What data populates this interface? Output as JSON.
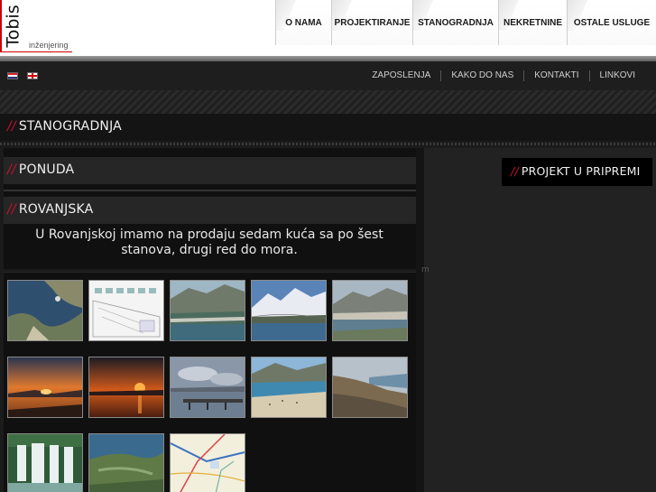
{
  "logo": {
    "name": "Tobis",
    "subtitle": "inženjering"
  },
  "main_nav": [
    {
      "label": "O NAMA"
    },
    {
      "label": "PROJEKTIRANJE"
    },
    {
      "label": "STANOGRADNJA"
    },
    {
      "label": "NEKRETNINE"
    },
    {
      "label": "OSTALE USLUGE"
    }
  ],
  "secondary_nav": [
    {
      "label": "ZAPOSLENJA"
    },
    {
      "label": "KAKO DO NAS"
    },
    {
      "label": "KONTAKTI"
    },
    {
      "label": "LINKOVI"
    }
  ],
  "page_title": {
    "prefix": "//",
    "text": "STANOGRADNJA"
  },
  "sections": {
    "ponuda": {
      "prefix": "//",
      "text": "PONUDA"
    },
    "rovanjska": {
      "prefix": "//",
      "text": "ROVANJSKA"
    }
  },
  "description": "U Rovanjskoj imamo na prodaju sedam kuća sa po šest stanova, drugi red do mora.",
  "sidebar": {
    "prefix": "//",
    "text": "PROJEKT U PRIPREMI"
  },
  "side_mark": "m",
  "gallery": [
    {
      "subject": "aerial-map"
    },
    {
      "subject": "site-plan"
    },
    {
      "subject": "mountain-bay"
    },
    {
      "subject": "snowy-mountains"
    },
    {
      "subject": "coast-mountains"
    },
    {
      "subject": "sunset-orange"
    },
    {
      "subject": "sunset-red"
    },
    {
      "subject": "pier-clouds"
    },
    {
      "subject": "beach"
    },
    {
      "subject": "hillside-sea"
    },
    {
      "subject": "waterfall"
    },
    {
      "subject": "aerial-green"
    },
    {
      "subject": "road-map"
    }
  ],
  "colors": {
    "accent": "#c8102e",
    "background": "#1b1b1b",
    "header": "#ffffff"
  }
}
